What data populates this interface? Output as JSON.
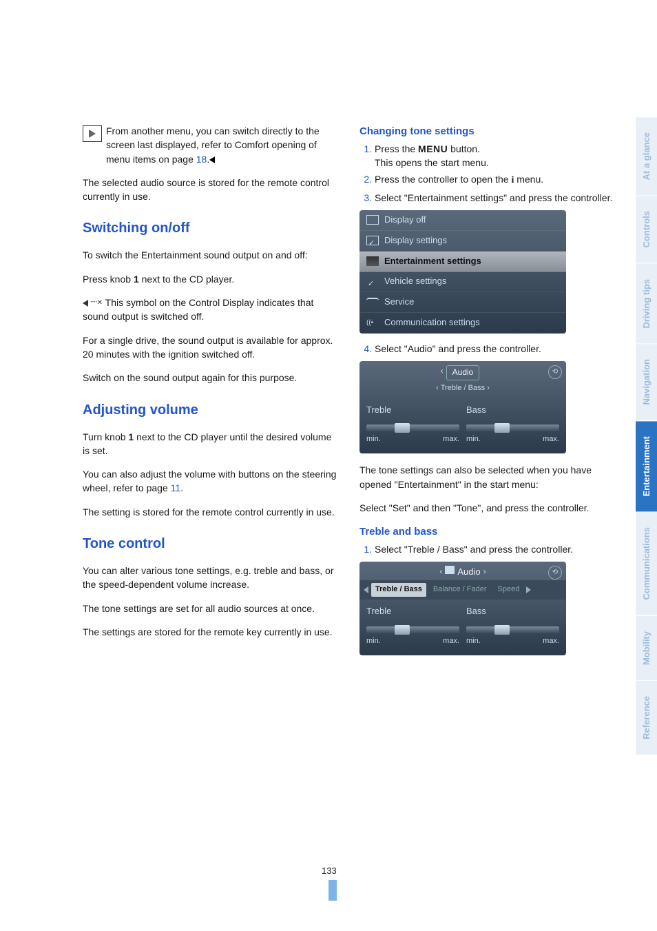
{
  "page_number": "133",
  "left": {
    "tip_text_1": "From another menu, you can switch directly to the screen last displayed, refer to Comfort opening of menu items on page ",
    "tip_page_link": "18",
    "tip_text_2": ".",
    "after_tip": "The selected audio source is stored for the remote control currently in use.",
    "h_switching": "Switching on/off",
    "switching_p1": "To switch the Entertainment sound output on and off:",
    "switching_p2a": "Press knob ",
    "switching_p2b": " next to the CD player.",
    "knob_num": "1",
    "switching_p3": " This symbol on the Control Display indicates that sound output is switched off.",
    "switching_p4": "For a single drive, the sound output is available for approx. 20 minutes with the ignition switched off.",
    "switching_p5": "Switch on the sound output again for this purpose.",
    "h_adjusting": "Adjusting volume",
    "adj_p1a": "Turn knob ",
    "adj_p1b": " next to the CD player until the desired volume is set.",
    "adj_p2a": "You can also adjust the volume with buttons on the steering wheel, refer to page ",
    "adj_page_link": "11",
    "adj_p2b": ".",
    "adj_p3": "The setting is stored for the remote control currently in use.",
    "h_tone": "Tone control",
    "tone_p1": "You can alter various tone settings, e.g. treble and bass, or the speed-dependent volume increase.",
    "tone_p2": "The tone settings are set for all audio sources at once.",
    "tone_p3": "The settings are stored for the remote key currently in use."
  },
  "right": {
    "h_changing": "Changing tone settings",
    "step1a": "Press the ",
    "step1_menu": "MENU",
    "step1b": " button.",
    "step1_sub": "This opens the start menu.",
    "step2a": "Press the controller to open the ",
    "step2_i": "i",
    "step2b": " menu.",
    "step3": "Select \"Entertainment settings\" and press the controller.",
    "menu_items": {
      "r1": "Display off",
      "r2": "Display settings",
      "r3": "Entertainment settings",
      "r4": "Vehicle settings",
      "r5": "Service",
      "r6": "Communication settings"
    },
    "step4": "Select \"Audio\" and press the controller.",
    "audio_tab": "Audio",
    "audio_sub": "Treble / Bass",
    "treble": "Treble",
    "bass": "Bass",
    "min": "min.",
    "max": "max.",
    "after_audio_p1": "The tone settings can also be selected when you have opened \"Entertainment\" in the start menu:",
    "after_audio_p2": "Select \"Set\" and then \"Tone\", and press the controller.",
    "h_treble_bass": "Treble and bass",
    "tb_step1": "Select \"Treble / Bass\" and press the controller.",
    "tabs": {
      "breadcrumb": "Audio",
      "t1": "Treble / Bass",
      "t2": "Balance / Fader",
      "t3": "Speed"
    }
  },
  "side_tabs": [
    "At a glance",
    "Controls",
    "Driving tips",
    "Navigation",
    "Entertainment",
    "Communications",
    "Mobility",
    "Reference"
  ],
  "active_tab": "Entertainment"
}
